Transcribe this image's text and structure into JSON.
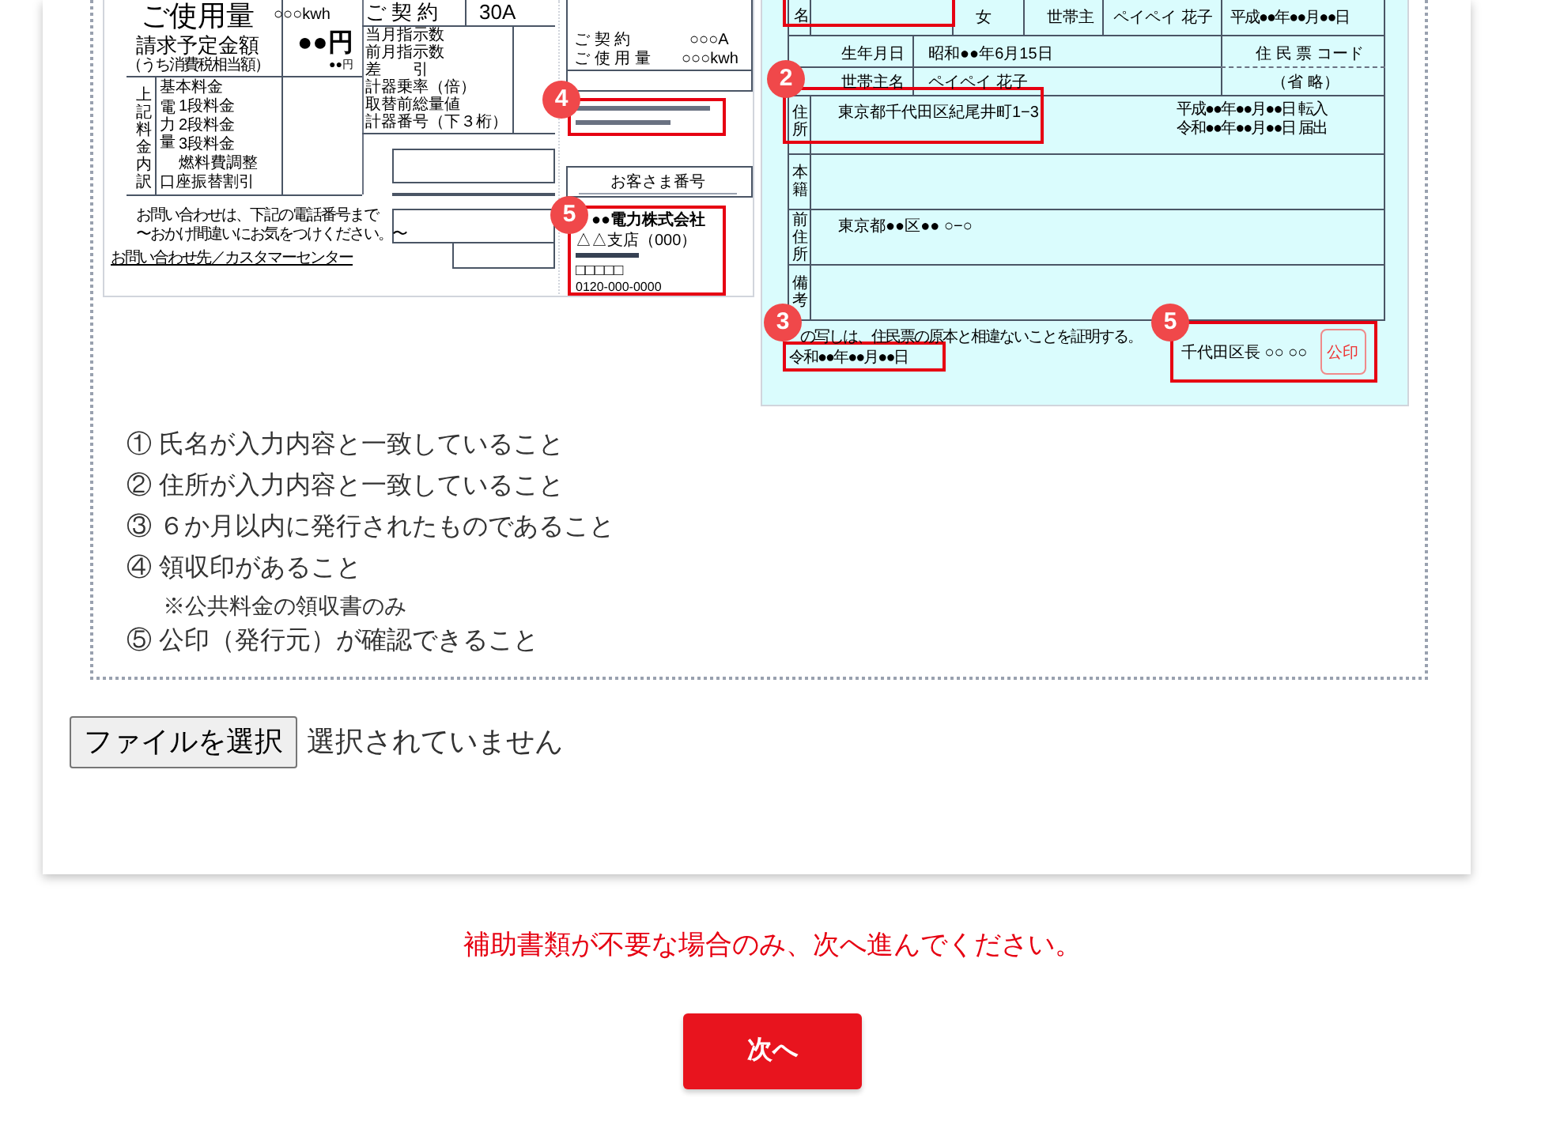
{
  "sample_documents": [
    {
      "kind": "utility_bill",
      "texts": [
        "ご使用量",
        "○○○kwh",
        "請求予定金額",
        "●●円",
        "（うち消費税相当額）",
        "●●円",
        "上記料金内訳",
        "電力量",
        "基本料金",
        "1段料金",
        "2段料金",
        "3段料金",
        "燃料費調整",
        "口座振替割引",
        "お問い合わせは、下記の電話番号まで",
        "〜おかけ間違いにお気をつけください。〜",
        "お問い合わせ先／カスタマーセンター",
        "ご 契 約",
        "30A",
        "当月指示数",
        "前月指示数",
        "差　　引",
        "計器乗率（倍）",
        "取替前総量値",
        "計器番号（下３桁）",
        "ご 契 約",
        "○○○A",
        "ご 使 用 量",
        "○○○kwh",
        "お客さま番号",
        "●●電力株式会社",
        "△△支店（000）",
        "□□□□□",
        "0120-000-0000"
      ],
      "callouts": [
        {
          "number": "4"
        },
        {
          "number": "5"
        }
      ]
    },
    {
      "kind": "resident_certificate",
      "texts": [
        "名",
        "女",
        "世帯主",
        "ペイペイ 花子",
        "平成●●年●●月●●日",
        "生年月日",
        "昭和●●年6月15日",
        "住 民 票 コード",
        "世帯主名",
        "ペイペイ 花子",
        "（省 略）",
        "住所",
        "東京都千代田区紀尾井町1−3",
        "平成●●年●●月●●日 転入",
        "令和●●年●●月●●日 届出",
        "本籍",
        "前住所",
        "東京都●●区●● ○−○",
        "備考",
        "の写しは、住民票の原本と相違ないことを証明する。",
        "令和●●年●●月●●日",
        "千代田区長 ○○ ○○",
        "公印"
      ],
      "callouts": [
        {
          "number": "2"
        },
        {
          "number": "3"
        },
        {
          "number": "5"
        }
      ]
    }
  ],
  "requirements": [
    {
      "marker": "①",
      "text": "氏名が入力内容と一致していること"
    },
    {
      "marker": "②",
      "text": "住所が入力内容と一致していること"
    },
    {
      "marker": "③",
      "text": "６か月以内に発行されたものであること"
    },
    {
      "marker": "④",
      "text": "領収印があること",
      "note": "※公共料金の領収書のみ"
    },
    {
      "marker": "⑤",
      "text": "公印（発行元）が確認できること"
    }
  ],
  "file_upload": {
    "button": "ファイルを選択",
    "status": "選択されていません"
  },
  "notice": "補助書類が不要な場合のみ、次へ進んでください。",
  "next_button": "次へ"
}
